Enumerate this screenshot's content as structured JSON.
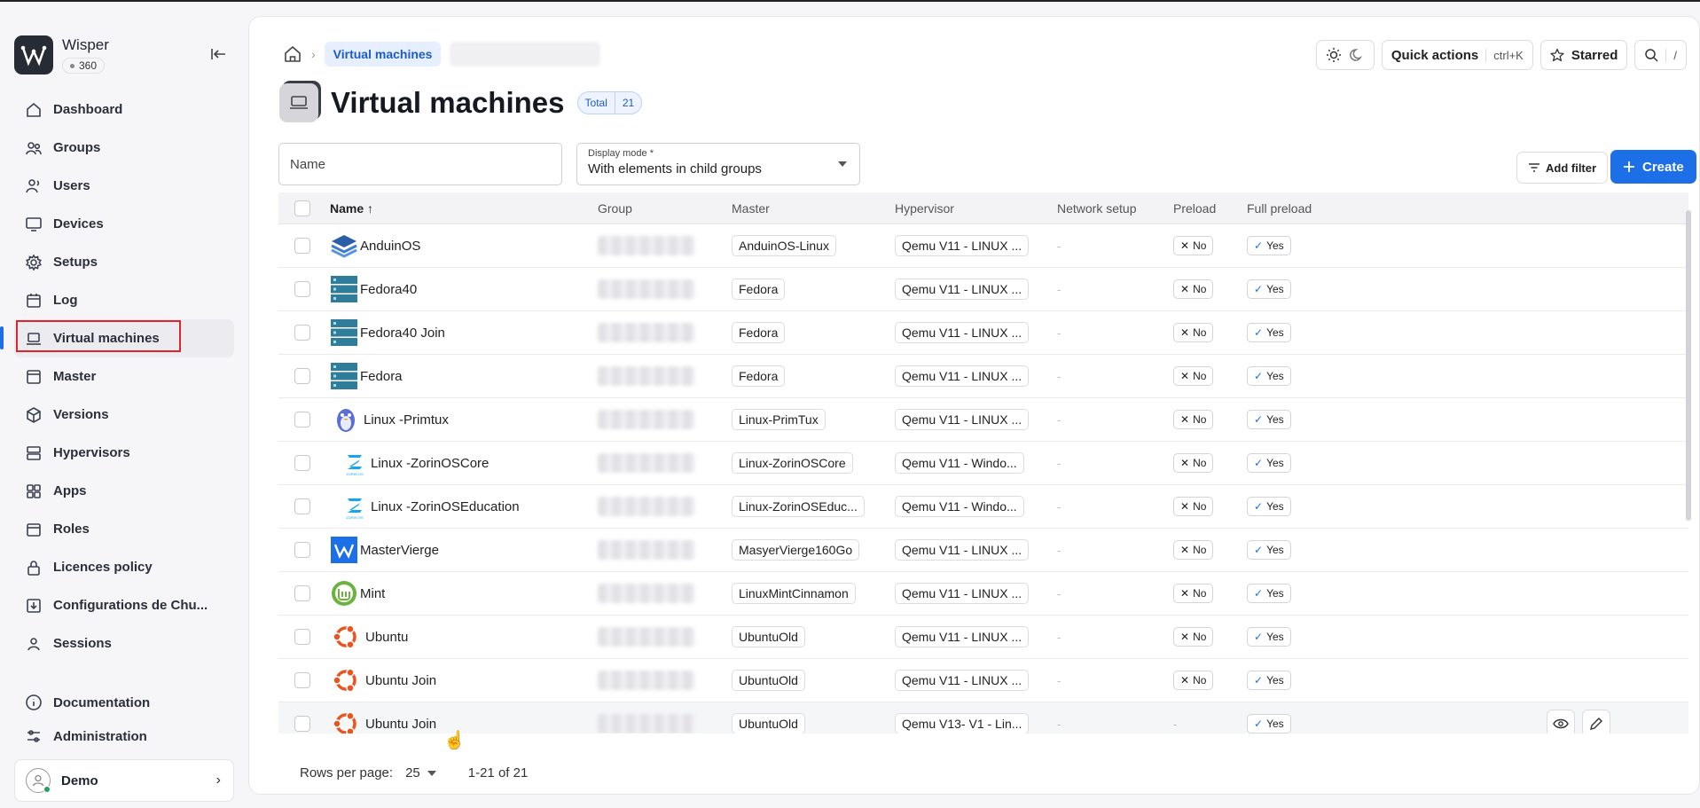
{
  "brand": {
    "name": "Wisper",
    "badge": "360"
  },
  "nav": {
    "items": [
      {
        "label": "Dashboard",
        "icon": "home-icon"
      },
      {
        "label": "Groups",
        "icon": "groups-icon"
      },
      {
        "label": "Users",
        "icon": "users-icon"
      },
      {
        "label": "Devices",
        "icon": "monitor-icon"
      },
      {
        "label": "Setups",
        "icon": "gear-icon"
      },
      {
        "label": "Log",
        "icon": "calendar-icon"
      },
      {
        "label": "Virtual machines",
        "icon": "laptop-icon"
      },
      {
        "label": "Master",
        "icon": "window-icon"
      },
      {
        "label": "Versions",
        "icon": "package-icon"
      },
      {
        "label": "Hypervisors",
        "icon": "server-icon"
      },
      {
        "label": "Apps",
        "icon": "grid-icon"
      },
      {
        "label": "Roles",
        "icon": "badge-icon"
      },
      {
        "label": "Licences policy",
        "icon": "lock-icon"
      },
      {
        "label": "Configurations de Chu...",
        "icon": "download-icon"
      },
      {
        "label": "Sessions",
        "icon": "person-pin-icon"
      }
    ],
    "active": "Virtual machines",
    "bottom": [
      {
        "label": "Documentation",
        "icon": "info-icon"
      },
      {
        "label": "Administration",
        "icon": "sliders-icon"
      }
    ]
  },
  "user": {
    "name": "Demo"
  },
  "breadcrumb": {
    "current": "Virtual machines"
  },
  "top_actions": {
    "quick_actions": "Quick actions",
    "quick_kbd": "ctrl+K",
    "starred": "Starred",
    "search_kbd": "/"
  },
  "page": {
    "title": "Virtual machines",
    "total_label": "Total",
    "total_value": "21"
  },
  "filters": {
    "name_placeholder": "Name",
    "display_mode_label": "Display mode *",
    "display_mode_value": "With elements in child groups",
    "add_filter": "Add filter",
    "create": "Create"
  },
  "table": {
    "columns": [
      "Name",
      "Group",
      "Master",
      "Hypervisor",
      "Network setup",
      "Preload",
      "Full preload"
    ],
    "rows": [
      {
        "name": "AnduinOS",
        "icon": "anduin-icon",
        "master": "AnduinOS-Linux",
        "hypervisor": "Qemu V11 - LINUX ...",
        "network": "-",
        "preload": "No",
        "full_preload": "Yes"
      },
      {
        "name": "Fedora40",
        "icon": "server-rack-icon",
        "master": "Fedora",
        "hypervisor": "Qemu V11 - LINUX ...",
        "network": "-",
        "preload": "No",
        "full_preload": "Yes"
      },
      {
        "name": "Fedora40 Join",
        "icon": "server-rack-icon",
        "master": "Fedora",
        "hypervisor": "Qemu V11 - LINUX ...",
        "network": "-",
        "preload": "No",
        "full_preload": "Yes"
      },
      {
        "name": "Fedora",
        "icon": "server-rack-icon",
        "master": "Fedora",
        "hypervisor": "Qemu V11 - LINUX ...",
        "network": "-",
        "preload": "No",
        "full_preload": "Yes"
      },
      {
        "name": "Linux -Primtux",
        "icon": "primtux-icon",
        "master": "Linux-PrimTux",
        "hypervisor": "Qemu V11 - LINUX ...",
        "network": "-",
        "preload": "No",
        "full_preload": "Yes"
      },
      {
        "name": "Linux -ZorinOSCore",
        "icon": "zorin-icon",
        "master": "Linux-ZorinOSCore",
        "hypervisor": "Qemu V11 - Windo...",
        "network": "-",
        "preload": "No",
        "full_preload": "Yes"
      },
      {
        "name": "Linux -ZorinOSEducation",
        "icon": "zorin-icon",
        "master": "Linux-ZorinOSEduc...",
        "hypervisor": "Qemu V11 - Windo...",
        "network": "-",
        "preload": "No",
        "full_preload": "Yes"
      },
      {
        "name": "MasterVierge",
        "icon": "wisper-icon",
        "master": "MasyerVierge160Go",
        "hypervisor": "Qemu V11 - LINUX ...",
        "network": "-",
        "preload": "No",
        "full_preload": "Yes"
      },
      {
        "name": "Mint",
        "icon": "mint-icon",
        "master": "LinuxMintCinnamon",
        "hypervisor": "Qemu V11 - LINUX ...",
        "network": "-",
        "preload": "No",
        "full_preload": "Yes"
      },
      {
        "name": "Ubuntu",
        "icon": "ubuntu-icon",
        "master": "UbuntuOld",
        "hypervisor": "Qemu V11 - LINUX ...",
        "network": "-",
        "preload": "No",
        "full_preload": "Yes"
      },
      {
        "name": "Ubuntu Join",
        "icon": "ubuntu-icon",
        "master": "UbuntuOld",
        "hypervisor": "Qemu V11 - LINUX ...",
        "network": "-",
        "preload": "No",
        "full_preload": "Yes"
      },
      {
        "name": "Ubuntu Join",
        "icon": "ubuntu-icon",
        "master": "UbuntuOld",
        "hypervisor": "Qemu V13- V1 - Lin...",
        "network": "-",
        "preload": "-",
        "full_preload": "Yes"
      }
    ]
  },
  "pagination": {
    "rows_per_page_label": "Rows per page:",
    "rows_per_page": "25",
    "range": "1-21 of 21"
  },
  "colors": {
    "accent": "#1d6fe8",
    "active_outline": "#e0242c",
    "ubuntu": "#e95420",
    "mint": "#6cb33e",
    "fedora_rack": "#2f7d9a"
  }
}
